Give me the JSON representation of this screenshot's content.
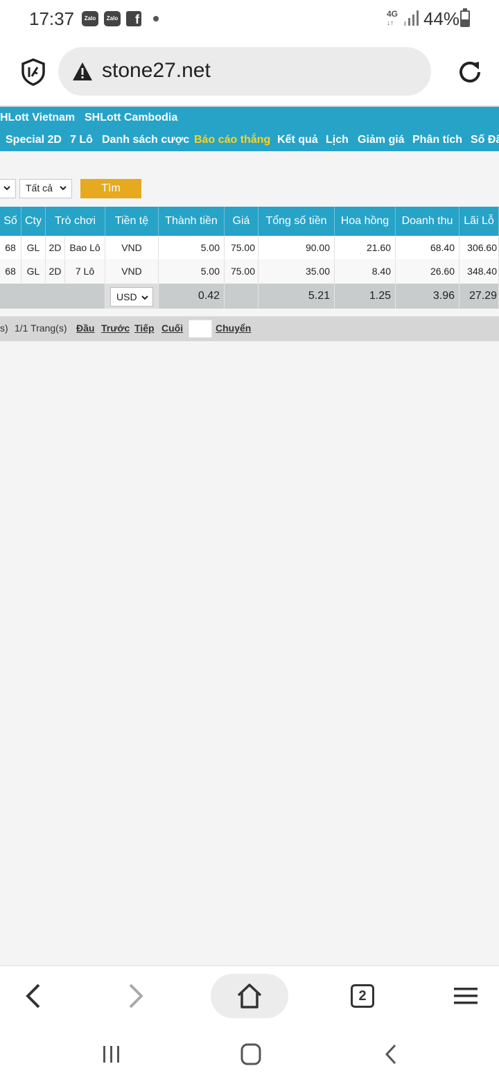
{
  "status_bar": {
    "time": "17:37",
    "notif1": "Zalo",
    "notif2": "Zalo",
    "net": "4G",
    "battery": "44%"
  },
  "browser": {
    "url": "stone27.net",
    "tab_count": "2"
  },
  "site_nav": {
    "row1": [
      "HLott Vietnam",
      "SHLott Cambodia"
    ],
    "row2": [
      "Special 2D",
      "7 Lô",
      "Danh sách cược",
      "Báo cáo thắng",
      "Kết quả",
      "Lịch",
      "Giảm giá",
      "Phân tích",
      "Số Đã"
    ],
    "active": "Báo cáo thắng"
  },
  "filters": {
    "filter2_value": "Tất cả",
    "search_button": "Tìm"
  },
  "table": {
    "headers": [
      "Số",
      "Cty",
      "Trò chơi",
      "Tiền tệ",
      "Thành tiền",
      "Giá",
      "Tổng số tiền",
      "Hoa hồng",
      "Doanh thu",
      "Lãi Lỗ"
    ],
    "rows": [
      {
        "so": "68",
        "cty": "GL",
        "game_type": "2D",
        "game_name": "Bao Lô",
        "currency": "VND",
        "amount": "5.00",
        "price": "75.00",
        "total": "90.00",
        "commission": "21.60",
        "revenue": "68.40",
        "profit": "306.60"
      },
      {
        "so": "68",
        "cty": "GL",
        "game_type": "2D",
        "game_name": "7 Lô",
        "currency": "VND",
        "amount": "5.00",
        "price": "75.00",
        "total": "35.00",
        "commission": "8.40",
        "revenue": "26.60",
        "profit": "348.40"
      }
    ],
    "totals": {
      "currency": "USD",
      "amount": "0.42",
      "total": "5.21",
      "commission": "1.25",
      "revenue": "3.96",
      "profit": "27.29"
    }
  },
  "pagination": {
    "records": "s)",
    "pages": "1/1 Trang(s)",
    "first": "Đầu",
    "prev": "Trước",
    "next": "Tiếp",
    "last": "Cuối",
    "go": "Chuyển"
  }
}
